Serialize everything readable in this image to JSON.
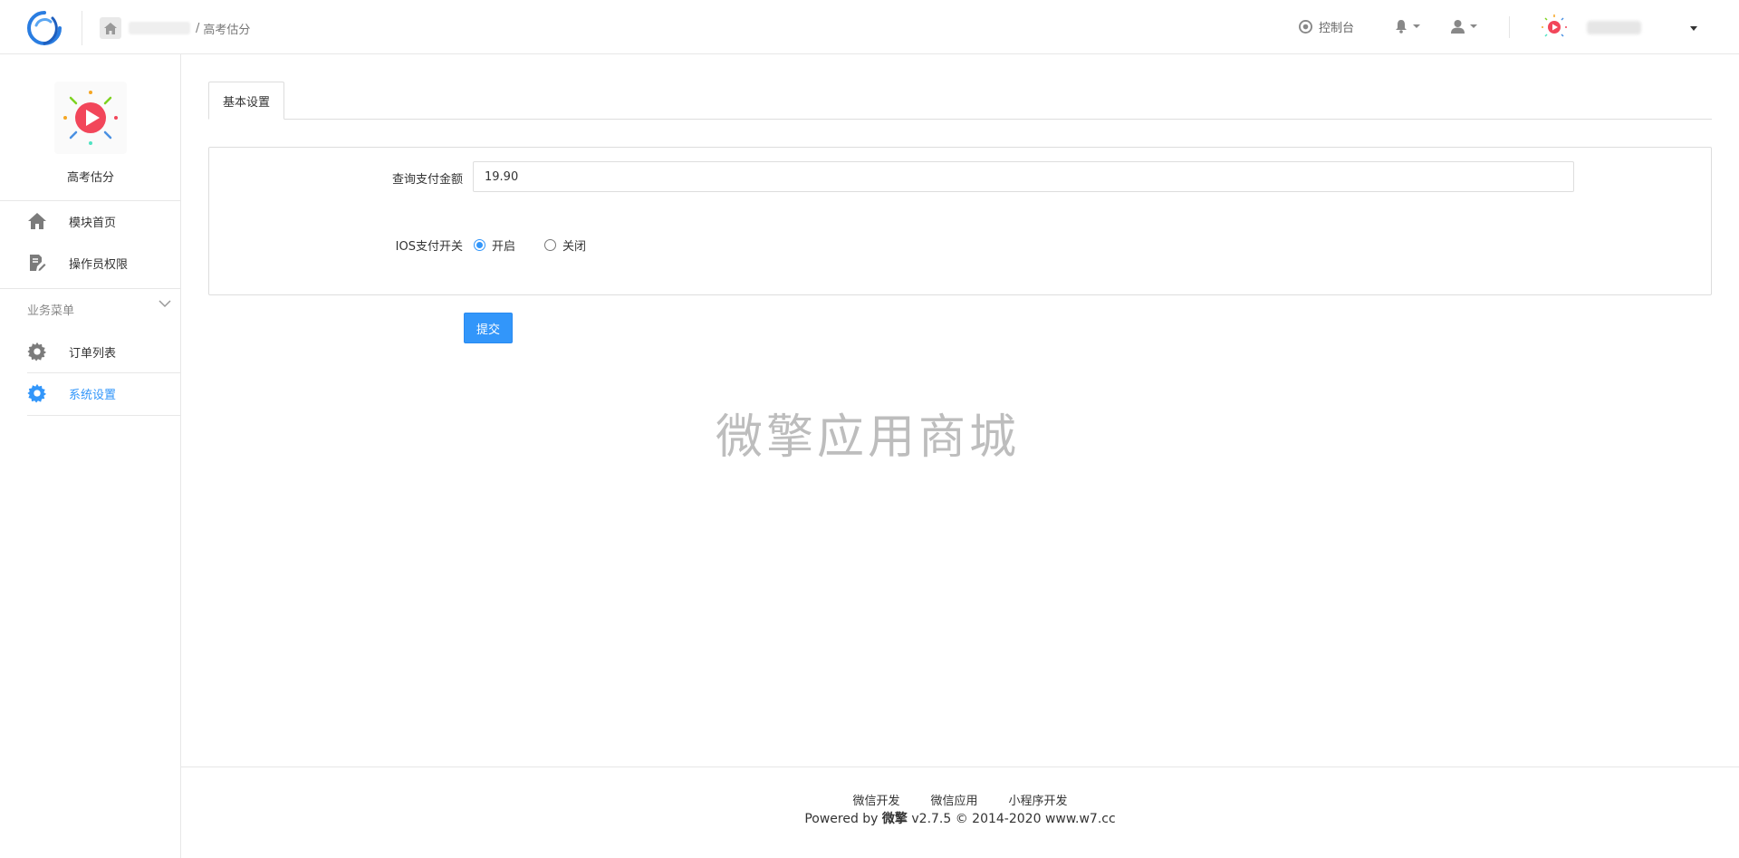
{
  "header": {
    "breadcrumb_sep": "/",
    "breadcrumb_current": "高考估分",
    "console_label": "控制台"
  },
  "sidebar": {
    "app_name": "高考估分",
    "items": [
      {
        "label": "模块首页",
        "icon": "home-icon"
      },
      {
        "label": "操作员权限",
        "icon": "edit-document-icon"
      }
    ],
    "group_label": "业务菜单",
    "group_items": [
      {
        "label": "订单列表",
        "icon": "gear-icon"
      },
      {
        "label": "系统设置",
        "icon": "gear-icon",
        "active": true
      }
    ]
  },
  "main": {
    "tab_label": "基本设置",
    "fields": {
      "amount_label": "查询支付金额",
      "amount_value": "19.90",
      "ios_label": "IOS支付开关",
      "ios_on_label": "开启",
      "ios_off_label": "关闭",
      "ios_selected": "开启"
    },
    "submit_label": "提交",
    "watermark": "微擎应用商城"
  },
  "footer": {
    "links": [
      "微信开发",
      "微信应用",
      "小程序开发"
    ],
    "powered_prefix": "Powered by ",
    "powered_brand": "微擎",
    "powered_suffix": " v2.7.5 © 2014-2020 www.w7.cc"
  },
  "colors": {
    "accent": "#3296fa",
    "border": "#e7e7e7"
  }
}
